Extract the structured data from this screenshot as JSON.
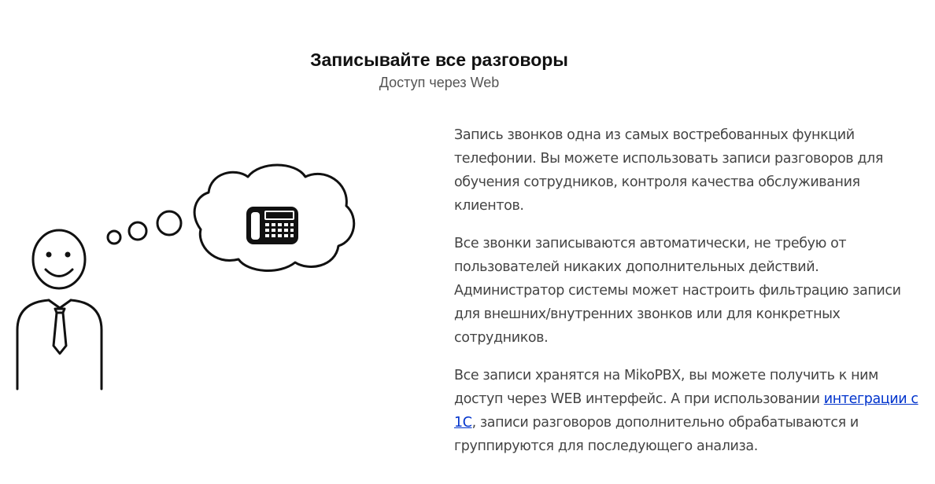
{
  "header": {
    "title": "Записывайте все разговоры",
    "subtitle": "Доступ через Web"
  },
  "illustration": {
    "person": "smiling-person-icon",
    "thought_bubble": "thought-cloud-icon",
    "phone": "desk-phone-icon"
  },
  "content": {
    "paragraph1": "Запись звонков одна из самых востребованных функций телефонии. Вы можете использовать записи разговоров для обучения сотрудников, контроля качества обслуживания клиентов.",
    "paragraph2": "Все звонки записываются автоматически, не требую от пользователей никаких дополнительных действий. Администратор системы может настроить фильтрацию записи для внешних/внутренних звонков или для конкретных сотрудников.",
    "paragraph3_before": "Все записи хранятся на MikoPBX, вы можете получить к ним доступ через WEB интерфейс. А при использовании ",
    "paragraph3_link": "интеграции с 1С",
    "paragraph3_after": ", записи разговоров дополнительно обрабатываются и группируются для последующего анализа."
  },
  "colors": {
    "link": "#0033cc",
    "text": "#444444",
    "title": "#111111"
  }
}
